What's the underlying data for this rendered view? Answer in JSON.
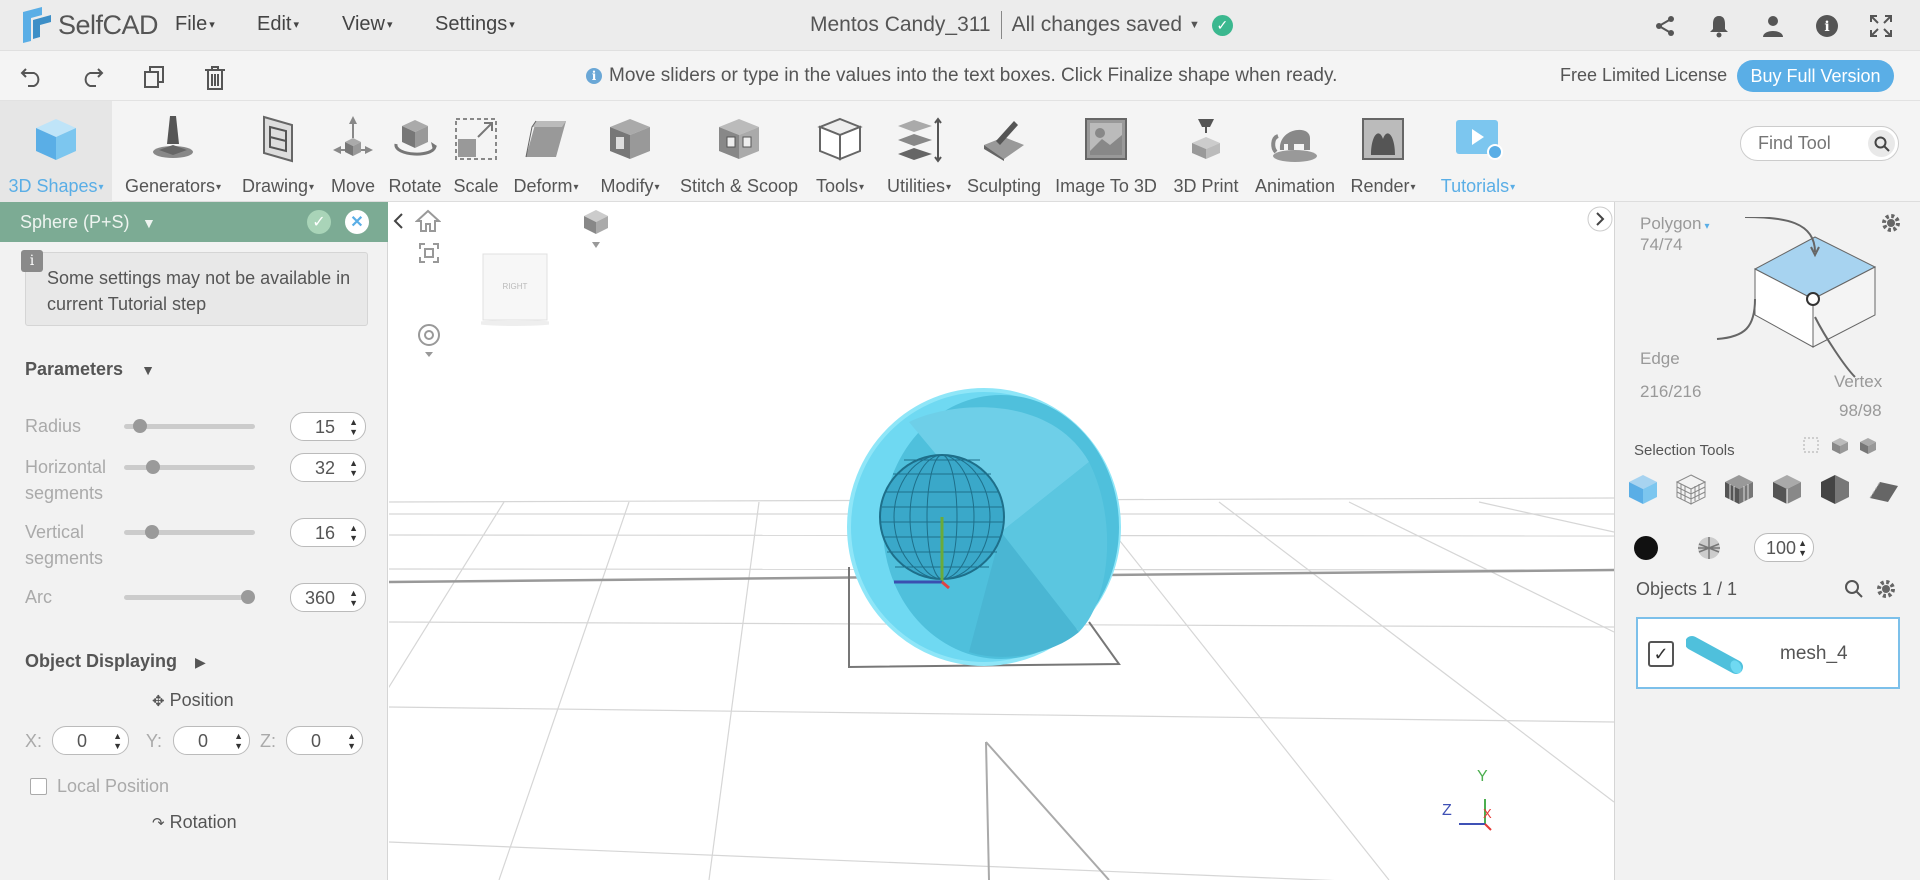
{
  "app": {
    "name": "SelfCAD"
  },
  "menu": {
    "file": "File",
    "edit": "Edit",
    "view": "View",
    "settings": "Settings"
  },
  "document": {
    "title": "Mentos Candy_311",
    "save_status": "All changes saved"
  },
  "hint": "Move sliders or type in the values into the text boxes. Click Finalize shape when ready.",
  "license": {
    "text": "Free Limited License",
    "buy": "Buy Full Version"
  },
  "tools": [
    "3D Shapes",
    "Generators",
    "Drawing",
    "Move",
    "Rotate",
    "Scale",
    "Deform",
    "Modify",
    "Stitch & Scoop",
    "Tools",
    "Utilities",
    "Sculpting",
    "Image To 3D",
    "3D Print",
    "Animation",
    "Render",
    "Tutorials"
  ],
  "find_tool": {
    "placeholder": "Find Tool"
  },
  "panel": {
    "title": "Sphere (P+S)",
    "notice": "Some settings may not be available in current Tutorial step",
    "parameters_title": "Parameters",
    "params": [
      {
        "label": "Radius",
        "value": "15",
        "slider": 0.08
      },
      {
        "label": "Horizontal segments",
        "value": "32",
        "slider": 0.19
      },
      {
        "label": "Vertical segments",
        "value": "16",
        "slider": 0.18
      },
      {
        "label": "Arc",
        "value": "360",
        "slider": 1.0
      }
    ],
    "object_displaying": "Object Displaying",
    "position_title": "Position",
    "x_label": "X:",
    "y_label": "Y:",
    "z_label": "Z:",
    "x": "0",
    "y": "0",
    "z": "0",
    "local_position": "Local Position",
    "rotation_title": "Rotation"
  },
  "viewcube": {
    "face": "RIGHT"
  },
  "axes": {
    "y": "Y",
    "z": "Z",
    "x": "X"
  },
  "right": {
    "polygon_label": "Polygon",
    "polygon_count": "74/74",
    "edge_label": "Edge",
    "edge_count": "216/216",
    "vertex_label": "Vertex",
    "vertex_count": "98/98",
    "selection_tools": "Selection Tools",
    "opacity": "100",
    "objects_title": "Objects 1 / 1",
    "object_name": "mesh_4"
  },
  "colors": {
    "accent": "#5aaee6",
    "panel_header": "#7cab94",
    "shape": "#5fd3ef",
    "saved": "#3bb88f"
  }
}
